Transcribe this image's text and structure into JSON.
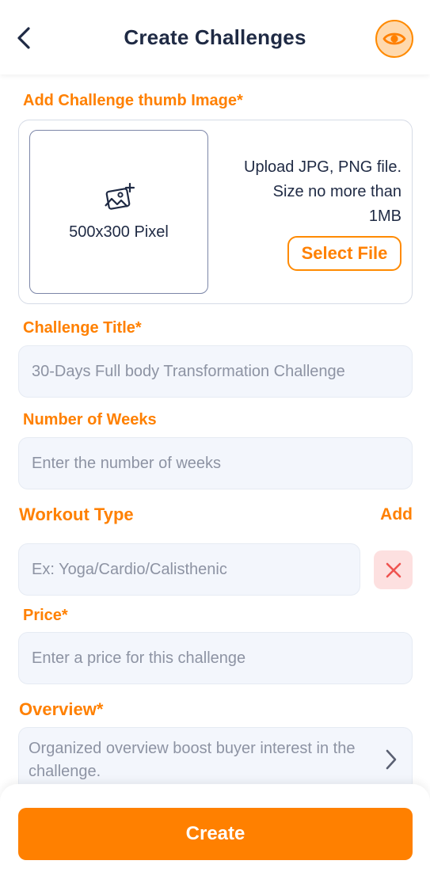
{
  "header": {
    "title": "Create Challenges",
    "back_icon": "chevron-left-icon",
    "preview_icon": "eye-icon"
  },
  "thumbnail": {
    "label": "Add Challenge thumb Image*",
    "dimensions_text": "500x300 Pixel",
    "info_line1": "Upload JPG, PNG file.",
    "info_line2": "Size no more than",
    "info_line3": "1MB",
    "select_button": "Select File"
  },
  "title_field": {
    "label": "Challenge Title*",
    "placeholder": "30-Days Full body Transformation Challenge"
  },
  "weeks_field": {
    "label": "Number of Weeks",
    "placeholder": "Enter the number of weeks"
  },
  "workout": {
    "label": "Workout Type",
    "add_label": "Add",
    "placeholder": "Ex: Yoga/Cardio/Calisthenic"
  },
  "price_field": {
    "label": "Price*",
    "placeholder": "Enter a price for this challenge"
  },
  "overview": {
    "label": "Overview*",
    "placeholder": "Organized overview boost buyer interest in the challenge."
  },
  "footer": {
    "create_button": "Create"
  },
  "colors": {
    "accent": "#ff8000",
    "title": "#1f2a44",
    "field_bg": "#f3f6fc",
    "remove_bg": "#fde0e0",
    "remove_icon": "#ef5350"
  }
}
